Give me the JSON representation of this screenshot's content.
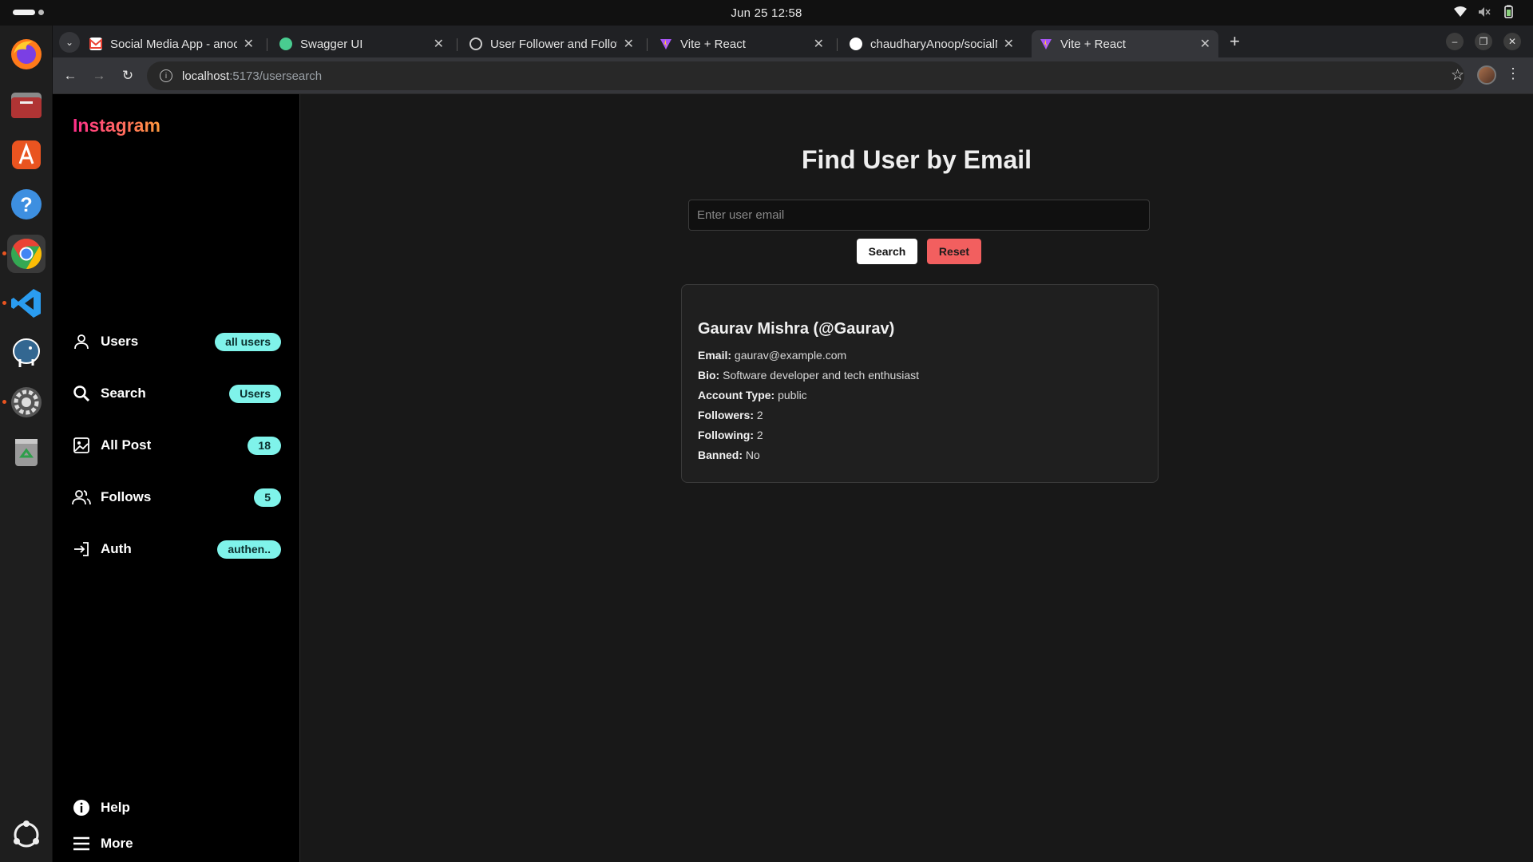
{
  "system": {
    "clock": "Jun 25  12:58"
  },
  "browser": {
    "tabs": [
      {
        "title": "Social Media App - anoop",
        "favicon": "gmail-icon",
        "color": "#ea4335"
      },
      {
        "title": "Swagger UI",
        "favicon": "swagger-icon",
        "color": "#49cc90"
      },
      {
        "title": "User Follower and Follow",
        "favicon": "postman-icon",
        "color": "#cccccc"
      },
      {
        "title": "Vite + React",
        "favicon": "vite-icon",
        "color": "#a855f7"
      },
      {
        "title": "chaudharyAnoop/socialM",
        "favicon": "github-icon",
        "color": "#ffffff"
      },
      {
        "title": "Vite + React",
        "favicon": "vite-icon",
        "color": "#a855f7"
      }
    ],
    "url_host": "localhost",
    "url_path": ":5173/usersearch"
  },
  "sidebar": {
    "brand": "Instagram",
    "items": [
      {
        "label": "Users",
        "badge": "all users",
        "icon": "user-icon"
      },
      {
        "label": "Search",
        "badge": "Users",
        "icon": "search-icon"
      },
      {
        "label": "All Post",
        "badge": "18",
        "icon": "image-icon"
      },
      {
        "label": "Follows",
        "badge": "5",
        "icon": "users-icon"
      },
      {
        "label": "Auth",
        "badge": "authen..",
        "icon": "login-icon"
      }
    ],
    "footer": [
      {
        "label": "Help",
        "icon": "info-icon"
      },
      {
        "label": "More",
        "icon": "menu-icon"
      }
    ]
  },
  "main": {
    "title": "Find User by Email",
    "search_placeholder": "Enter user email",
    "search_label": "Search",
    "reset_label": "Reset",
    "result": {
      "name": "Gaurav Mishra (@Gaurav)",
      "fields": [
        {
          "label": "Email:",
          "value": "gaurav@example.com"
        },
        {
          "label": "Bio:",
          "value": "Software developer and tech enthusiast"
        },
        {
          "label": "Account Type:",
          "value": "public"
        },
        {
          "label": "Followers:",
          "value": "2"
        },
        {
          "label": "Following:",
          "value": "2"
        },
        {
          "label": "Banned:",
          "value": "No"
        }
      ]
    }
  },
  "colors": {
    "accent": "#7ff3ea",
    "reset": "#f25f5f",
    "brand_from": "#ff2d8a",
    "brand_to": "#ff9a3c"
  }
}
